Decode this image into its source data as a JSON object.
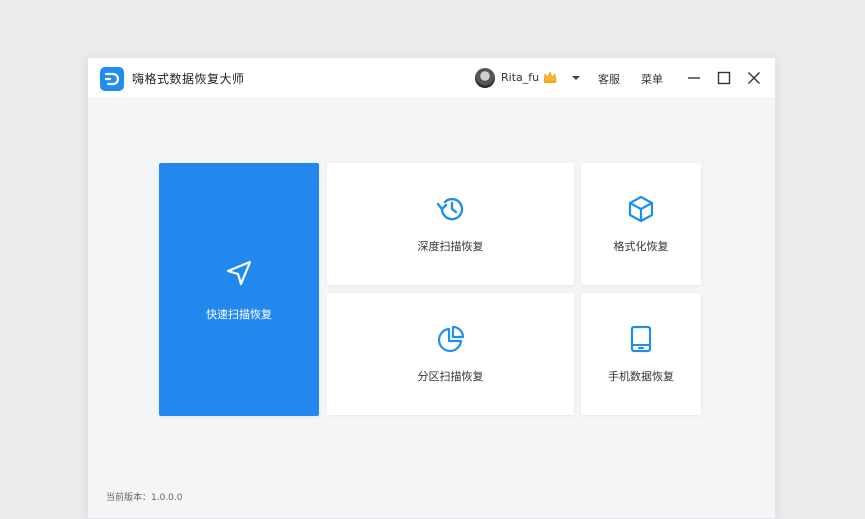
{
  "app": {
    "title": "嗨格式数据恢复大师"
  },
  "header": {
    "username": "Rita_fu",
    "service_label": "客服",
    "menu_label": "菜单"
  },
  "cards": {
    "quick_scan": "快速扫描恢复",
    "deep_scan": "深度扫描恢复",
    "format_recovery": "格式化恢复",
    "partition_scan": "分区扫描恢复",
    "phone_recovery": "手机数据恢复"
  },
  "footer": {
    "version": "当前版本：1.0.0.0"
  },
  "colors": {
    "accent": "#2288ee",
    "icon": "#1f8eee",
    "crown": "#f5b82e"
  },
  "icons": {
    "logo": "app-logo-icon",
    "crown": "vip-crown-icon",
    "quick_scan": "navigation-arrow-icon",
    "deep_scan": "history-clock-icon",
    "format_recovery": "cube-icon",
    "partition_scan": "pie-chart-icon",
    "phone_recovery": "tablet-icon"
  }
}
